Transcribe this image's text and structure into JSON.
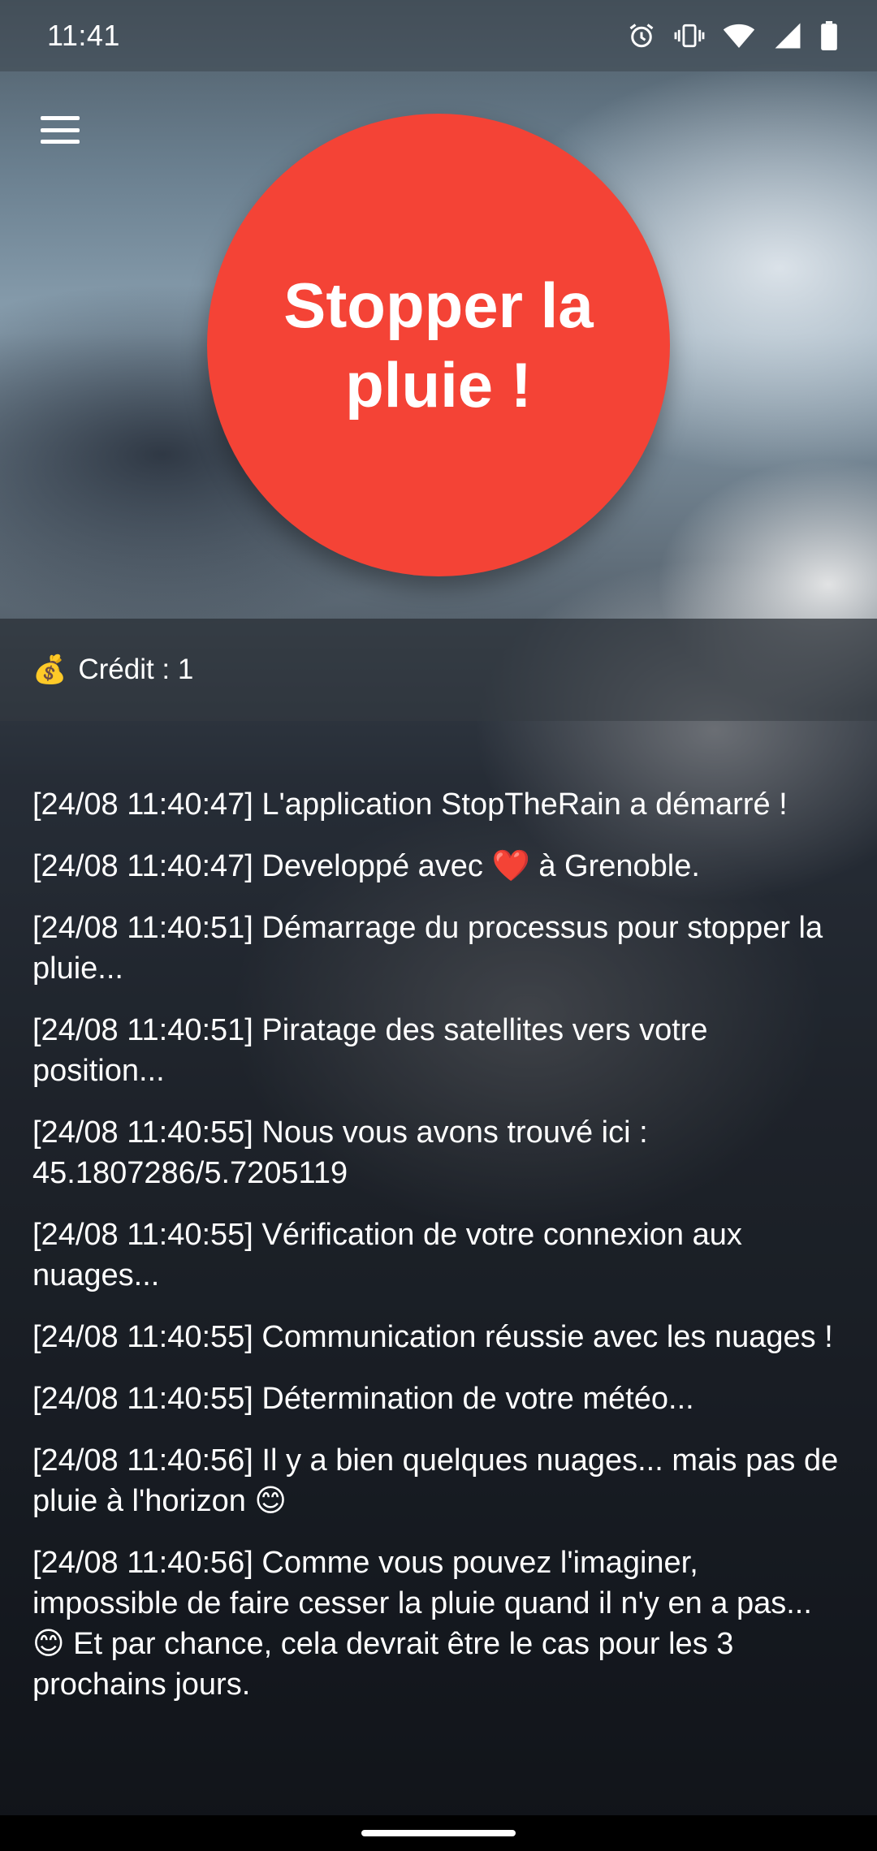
{
  "status_bar": {
    "time": "11:41",
    "icons": [
      "alarm-icon",
      "vibrate-icon",
      "wifi-icon",
      "signal-icon",
      "battery-icon"
    ]
  },
  "main": {
    "stop_button_label": "Stopper la pluie !",
    "credit_icon": "💰",
    "credit_text": "Crédit : 1"
  },
  "log": [
    "[24/08 11:40:47] L'application StopTheRain a démarré !",
    "[24/08 11:40:47] Developpé avec ❤️ à Grenoble.",
    "[24/08 11:40:51] Démarrage du processus pour stopper la pluie...",
    "[24/08 11:40:51] Piratage des satellites vers votre position...",
    "[24/08 11:40:55] Nous vous avons trouvé ici : 45.1807286/5.7205119",
    "[24/08 11:40:55] Vérification de votre connexion aux nuages...",
    "[24/08 11:40:55] Communication réussie avec les nuages !",
    "[24/08 11:40:55] Détermination de votre météo...",
    "[24/08 11:40:56] Il y a bien quelques nuages... mais pas de pluie à l'horizon 😊",
    "[24/08 11:40:56] Comme vous pouvez l'imaginer, impossible de faire cesser la pluie quand il n'y en a pas... 😊 Et par chance, cela devrait être le cas pour les 3 prochains jours."
  ],
  "colors": {
    "accent": "#f44336",
    "text": "#ffffff"
  }
}
